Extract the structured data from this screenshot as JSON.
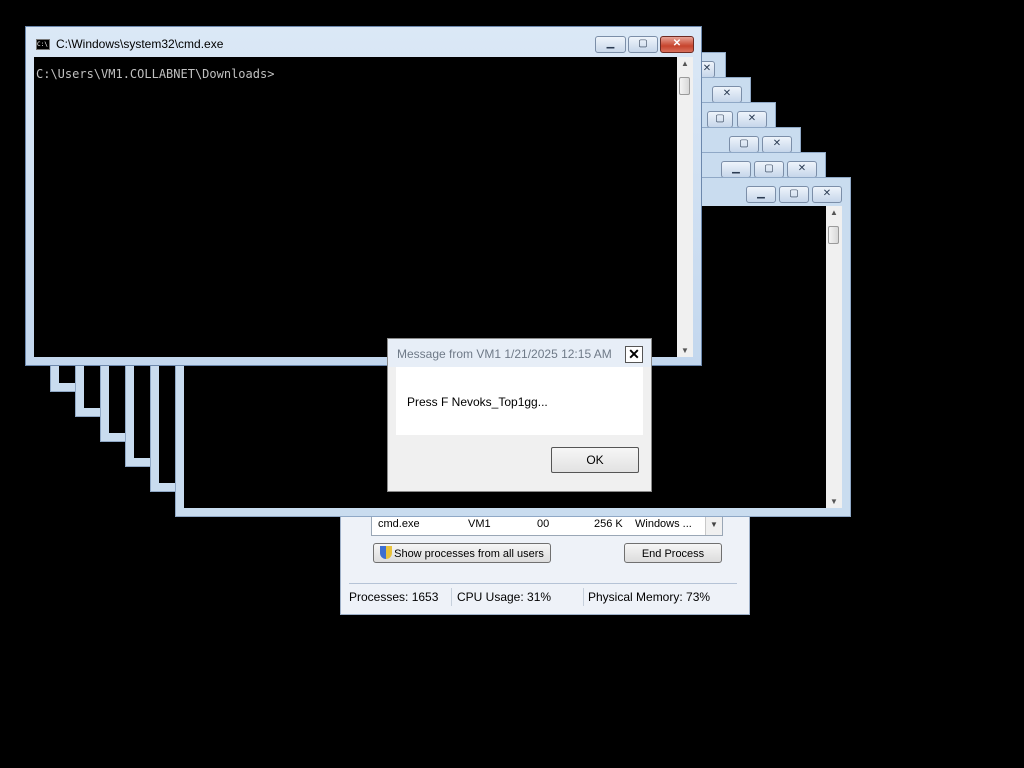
{
  "cmd_window": {
    "title": "C:\\Windows\\system32\\cmd.exe",
    "prompt": "C:\\Users\\VM1.COLLABNET\\Downloads>",
    "minimize": "▁",
    "maximize": "▢",
    "close": "✕"
  },
  "stacked_windows": {
    "minimize": "▁",
    "maximize": "▢",
    "close": "✕"
  },
  "task_manager": {
    "process_row": {
      "image_name": "cmd.exe",
      "user": "VM1",
      "cpu": "00",
      "memory": "256 K",
      "description": "Windows ..."
    },
    "show_all_button": "Show processes from all users",
    "end_process_button": "End Process",
    "status": {
      "processes": "Processes: 1653",
      "cpu_usage": "CPU Usage: 31%",
      "physical_memory": "Physical Memory: 73%"
    }
  },
  "message_box": {
    "caption": "Message from VM1 1/21/2025 12:15 AM",
    "text": "Press F Nevoks_Top1gg...",
    "ok_label": "OK",
    "close_glyph": "✕"
  },
  "icons": [
    "cmd-icon",
    "shield-icon",
    "chevron-down-icon",
    "close-icon",
    "minimize-icon",
    "maximize-icon"
  ]
}
